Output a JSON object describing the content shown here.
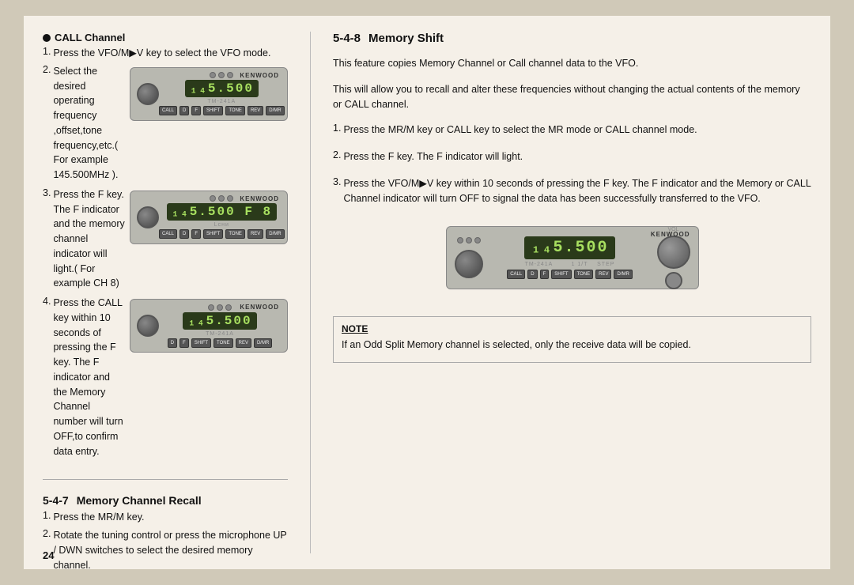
{
  "page": {
    "number": "24",
    "background": "#f5f0e8"
  },
  "left": {
    "call_channel_header": "CALL Channel",
    "steps": [
      {
        "num": "1.",
        "text": "Press the VFO/M▶V key to select the VFO mode."
      },
      {
        "num": "2.",
        "text": "Select the desired operating  frequency ,offset,tone frequency,etc.( For example 145.500MHz )."
      },
      {
        "num": "3.",
        "text": "Press the F key. The F indicator and the memory channel  indicator  will light.( For example CH 8)"
      },
      {
        "num": "4.",
        "text": "Press the CALL key within 10 seconds of pressing the F key. The F indicator and the Memory Channel number will turn OFF,to confirm data entry."
      }
    ],
    "radio1_display": "₁₄5.5̲0̲0̲",
    "radio2_display": "₁₄5.500 F 8",
    "radio3_display": "₁₄5.500",
    "section_547_header": "5-4-7",
    "section_547_title": "Memory Channel Recall",
    "recall_steps": [
      {
        "num": "1.",
        "text": "Press the MR/M key."
      },
      {
        "num": "2.",
        "text": "Rotate the tuning control or press the microphone UP / DWN switches to select the desired memory channel."
      }
    ]
  },
  "right": {
    "section_548_header": "5-4-8",
    "section_548_title": "Memory Shift",
    "para1": "This feature copies Memory Channel or Call channel data to the VFO.",
    "para2": "This will allow you to recall and alter these frequencies without changing the actual contents of the memory or CALL channel.",
    "steps": [
      {
        "num": "1.",
        "text": "Press the MR/M key or CALL key to select the MR mode or CALL channel mode."
      },
      {
        "num": "2.",
        "text": "Press the F key. The F indicator  will light."
      },
      {
        "num": "3.",
        "text": "Press the VFO/M▶V key within 10 seconds of pressing the F key. The F indicator and the Memory or CALL Channel indicator  will turn OFF to signal the data has been successfully transferred to the VFO."
      }
    ],
    "radio_display": "₁₄5.500",
    "note_title": "NOTE",
    "note_text": "If an Odd Split Memory channel is selected, only the receive data will be copied."
  }
}
